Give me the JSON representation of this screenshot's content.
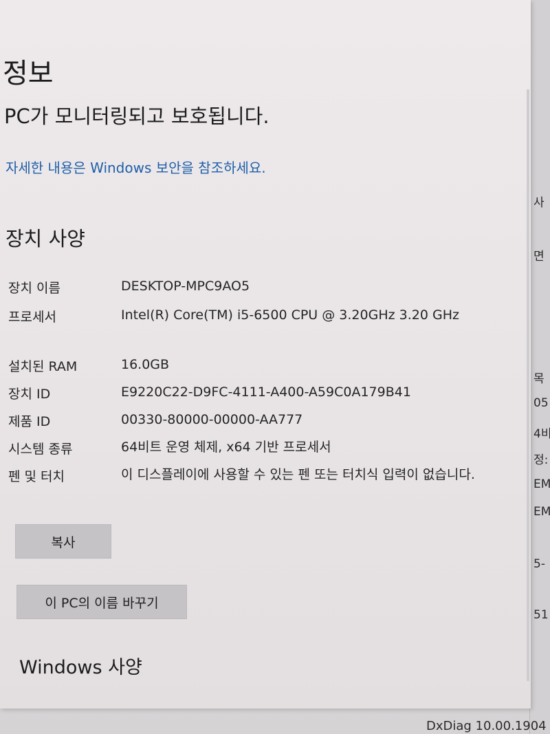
{
  "header": {
    "title": "정보",
    "protection_status": "PC가 모니터링되고 보호됩니다.",
    "security_link": "자세한 내용은 Windows 보안을 참조하세요."
  },
  "device_specs": {
    "title": "장치 사양",
    "rows": [
      {
        "label": "장치 이름",
        "value": "DESKTOP-MPC9AO5"
      },
      {
        "label": "프로세서",
        "value": "Intel(R) Core(TM) i5-6500 CPU @ 3.20GHz   3.20 GHz"
      },
      {
        "label": "설치된 RAM",
        "value": "16.0GB"
      },
      {
        "label": "장치 ID",
        "value": "E9220C22-D9FC-4111-A400-A59C0A179B41"
      },
      {
        "label": "제품 ID",
        "value": "00330-80000-00000-AA777"
      },
      {
        "label": "시스템 종류",
        "value": "64비트 운영 체제, x64 기반 프로세서"
      },
      {
        "label": "펜 및 터치",
        "value": "이 디스플레이에 사용할 수 있는 펜 또는 터치식 입력이 없습니다."
      }
    ],
    "copy_button": "복사",
    "rename_button": "이 PC의 이름 바꾸기"
  },
  "windows_specs": {
    "title": "Windows 사양"
  },
  "background_window": {
    "fragments": [
      "사",
      "면",
      "목",
      "05",
      "4비",
      "정:",
      "EM",
      "EM",
      "5-",
      "51"
    ],
    "footer_text": "DxDiag 10.00.1904"
  }
}
